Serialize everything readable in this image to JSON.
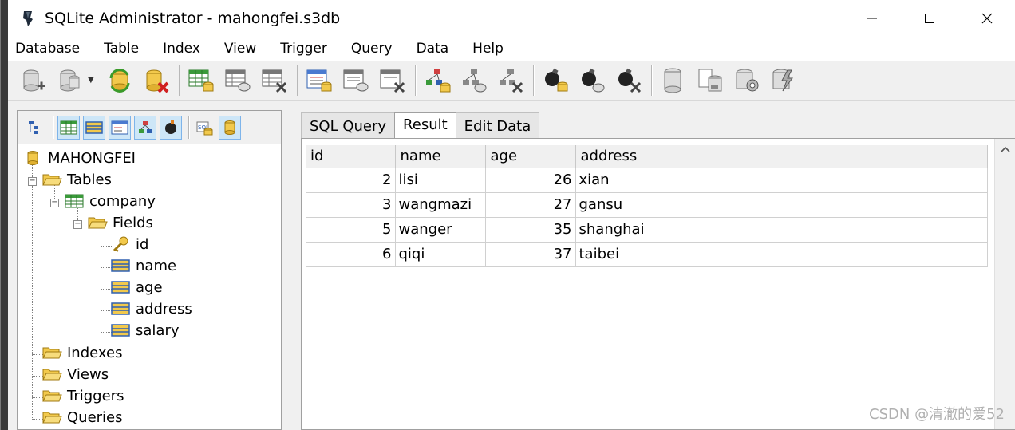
{
  "window": {
    "title": "SQLite Administrator - mahongfei.s3db"
  },
  "menu": [
    "Database",
    "Table",
    "Index",
    "View",
    "Trigger",
    "Query",
    "Data",
    "Help"
  ],
  "toolbar": {
    "buttons": [
      "new-database",
      "open-database",
      "refresh",
      "delete-database",
      "create-table",
      "edit-table",
      "delete-table",
      "create-index",
      "edit-index",
      "delete-index",
      "create-view",
      "edit-view",
      "delete-view",
      "create-trigger",
      "edit-trigger",
      "delete-trigger",
      "export",
      "import",
      "settings",
      "compact"
    ]
  },
  "tree": {
    "root": "MAHONGFEI",
    "tables_label": "Tables",
    "table_name": "company",
    "fields_label": "Fields",
    "fields": [
      "id",
      "name",
      "age",
      "address",
      "salary"
    ],
    "indexes_label": "Indexes",
    "views_label": "Views",
    "triggers_label": "Triggers",
    "queries_label": "Queries"
  },
  "tabs": [
    "SQL Query",
    "Result",
    "Edit Data"
  ],
  "active_tab": "Result",
  "grid": {
    "columns": [
      "id",
      "name",
      "age",
      "address"
    ],
    "rows": [
      [
        "2",
        "lisi",
        "26",
        "xian"
      ],
      [
        "3",
        "wangmazi",
        "27",
        "gansu"
      ],
      [
        "5",
        "wanger",
        "35",
        "shanghai"
      ],
      [
        "6",
        "qiqi",
        "37",
        "taibei"
      ]
    ]
  },
  "watermark": "CSDN @清澈的爱52"
}
